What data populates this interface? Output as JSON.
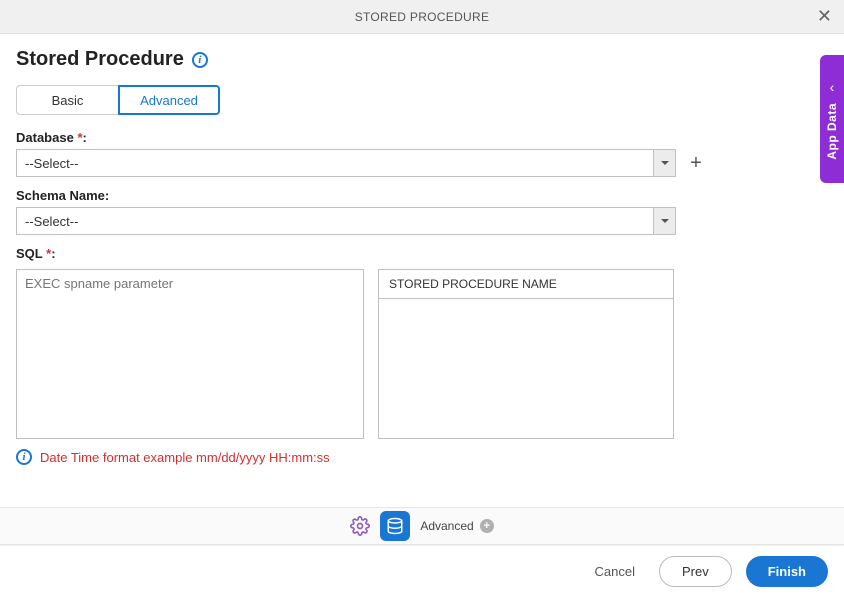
{
  "titleBar": {
    "title": "STORED PROCEDURE"
  },
  "pageTitle": "Stored Procedure",
  "tabs": {
    "basic": "Basic",
    "advanced": "Advanced"
  },
  "database": {
    "label": "Database",
    "required": "*",
    "value": "--Select--"
  },
  "schema": {
    "label": "Schema Name:",
    "value": "--Select--"
  },
  "sql": {
    "label": "SQL",
    "required": "*",
    "placeholder": "EXEC spname parameter"
  },
  "spName": {
    "header": "STORED PROCEDURE NAME"
  },
  "hint": "Date Time format example mm/dd/yyyy HH:mm:ss",
  "stepBar": {
    "advancedLabel": "Advanced"
  },
  "footer": {
    "cancel": "Cancel",
    "prev": "Prev",
    "finish": "Finish"
  },
  "sideTab": {
    "label": "App Data"
  }
}
